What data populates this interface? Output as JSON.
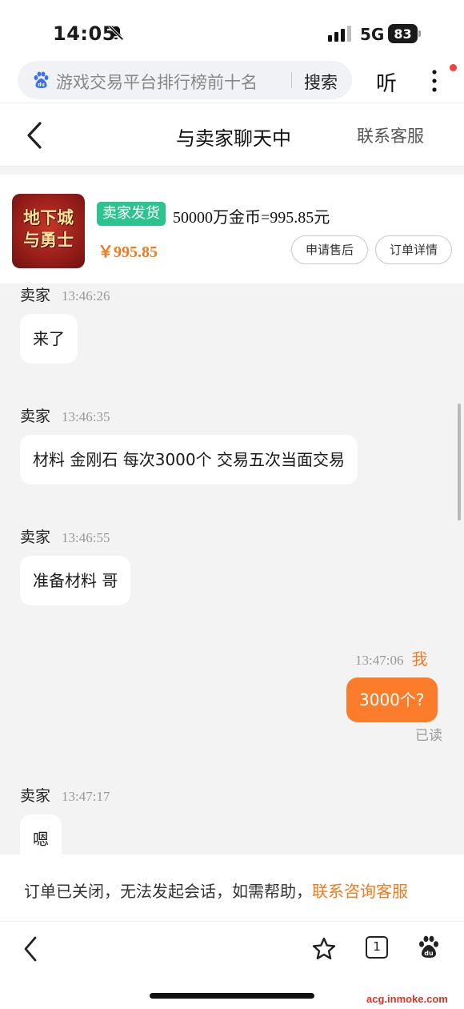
{
  "status_bar": {
    "time": "14:05",
    "network": "5G",
    "battery": "83"
  },
  "search": {
    "query": "游戏交易平台排行榜前十名",
    "button_label": "搜索",
    "listen_label": "听"
  },
  "header": {
    "title": "与卖家聊天中",
    "customer_service": "联系客服"
  },
  "order": {
    "game_name_line1": "地下城",
    "game_name_line2": "与勇士",
    "ship_badge": "卖家发货",
    "title": "50000万金币=995.85元",
    "price": "￥995.85",
    "after_sale_label": "申请售后",
    "detail_label": "订单详情"
  },
  "messages": [
    {
      "sender": "卖家",
      "time": "13:46:26",
      "text": "来了"
    },
    {
      "sender": "卖家",
      "time": "13:46:35",
      "text": "材料 金刚石 每次3000个 交易五次当面交易"
    },
    {
      "sender": "卖家",
      "time": "13:46:55",
      "text": "准备材料 哥"
    },
    {
      "sender": "我",
      "time": "13:47:06",
      "text": "3000个?",
      "status": "已读"
    },
    {
      "sender": "卖家",
      "time": "13:47:17",
      "text": "嗯"
    }
  ],
  "notice": {
    "text": "订单已关闭，无法发起会话，如需帮助，",
    "link": "联系咨询客服"
  },
  "toolbar": {
    "tab_count": "1"
  },
  "watermark": "acg.inmoke.com",
  "colors": {
    "accent_orange": "#f07a1f",
    "my_bubble": "#fb7d2c",
    "ship_badge_green": "#2bc48f"
  }
}
